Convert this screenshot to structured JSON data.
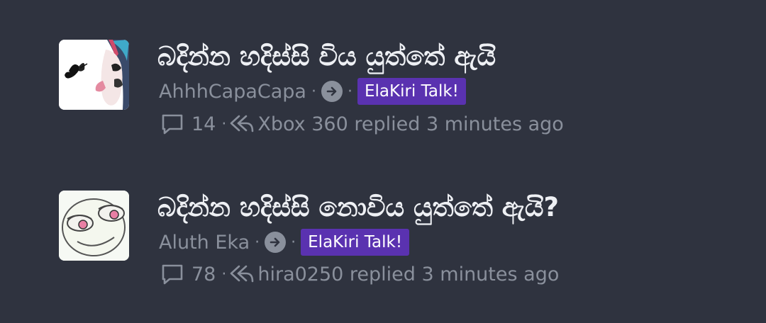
{
  "threads": [
    {
      "title": "බදින්න හදිස්සි විය යුත්තේ ඇයි",
      "author": "AhhhCapaCapa",
      "forum": "ElaKiri Talk!",
      "reply_count": "14",
      "last_reply": "Xbox 360 replied 3 minutes ago",
      "avatar_icon": "anime-girl-butterfly-avatar"
    },
    {
      "title": "බදින්න හදිස්සි නොවිය යුත්තේ ඇයි?",
      "author": "Aluth Eka",
      "forum": "ElaKiri Talk!",
      "reply_count": "78",
      "last_reply": "hira0250 replied 3 minutes ago",
      "avatar_icon": "troll-face-avatar"
    }
  ],
  "separator": "·",
  "colors": {
    "background": "#2f333f",
    "title": "#eef0f4",
    "meta": "#8a909c",
    "badge": "#5a32b0"
  }
}
